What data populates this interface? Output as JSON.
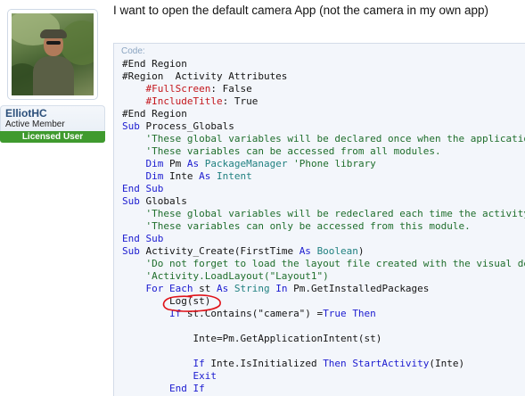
{
  "user": {
    "name": "ElliotHC",
    "title": "Active Member",
    "badge": "Licensed User"
  },
  "post": {
    "question": "I want to open the default camera App (not the camera in my own app)"
  },
  "code": {
    "label": "Code:",
    "lines": [
      [
        [
          "#End Region",
          "plain"
        ]
      ],
      [
        [
          "#Region  Activity Attributes",
          "plain"
        ]
      ],
      [
        [
          "    ",
          "plain"
        ],
        [
          "#FullScreen",
          "pragma"
        ],
        [
          ": ",
          "plain"
        ],
        [
          "False",
          "plain"
        ]
      ],
      [
        [
          "    ",
          "plain"
        ],
        [
          "#IncludeTitle",
          "pragma"
        ],
        [
          ": ",
          "plain"
        ],
        [
          "True",
          "plain"
        ]
      ],
      [
        [
          "#End Region",
          "plain"
        ]
      ],
      [
        [
          "Sub",
          "kw"
        ],
        [
          " Process_Globals",
          "plain"
        ]
      ],
      [
        [
          "    'These global variables will be declared once when the application",
          "comment"
        ]
      ],
      [
        [
          "    'These variables can be accessed from all modules.",
          "comment"
        ]
      ],
      [
        [
          "    ",
          "plain"
        ],
        [
          "Dim",
          "kw"
        ],
        [
          " Pm ",
          "plain"
        ],
        [
          "As",
          "kw"
        ],
        [
          " ",
          "plain"
        ],
        [
          "PackageManager",
          "type"
        ],
        [
          " ",
          "plain"
        ],
        [
          "'Phone library",
          "comment"
        ]
      ],
      [
        [
          "    ",
          "plain"
        ],
        [
          "Dim",
          "kw"
        ],
        [
          " Inte ",
          "plain"
        ],
        [
          "As",
          "kw"
        ],
        [
          " ",
          "plain"
        ],
        [
          "Intent",
          "type"
        ]
      ],
      [
        [
          "End Sub",
          "kw"
        ]
      ],
      [
        [
          "Sub",
          "kw"
        ],
        [
          " Globals",
          "plain"
        ]
      ],
      [
        [
          "    'These global variables will be redeclared each time the activity",
          "comment"
        ]
      ],
      [
        [
          "    'These variables can only be accessed from this module.",
          "comment"
        ]
      ],
      [
        [
          "End Sub",
          "kw"
        ]
      ],
      [
        [
          "Sub",
          "kw"
        ],
        [
          " Activity_Create(FirstTime ",
          "plain"
        ],
        [
          "As",
          "kw"
        ],
        [
          " ",
          "plain"
        ],
        [
          "Boolean",
          "type"
        ],
        [
          ")",
          "plain"
        ]
      ],
      [
        [
          "    'Do not forget to load the layout file created with the visual de",
          "comment"
        ]
      ],
      [
        [
          "    'Activity.LoadLayout(\"Layout1\")",
          "comment"
        ]
      ],
      [
        [
          "    ",
          "plain"
        ],
        [
          "For Each",
          "kw"
        ],
        [
          " st ",
          "plain"
        ],
        [
          "As",
          "kw"
        ],
        [
          " ",
          "plain"
        ],
        [
          "String",
          "type"
        ],
        [
          " ",
          "plain"
        ],
        [
          "In",
          "kw"
        ],
        [
          " Pm.GetInstalledPackages",
          "plain"
        ]
      ],
      [
        [
          "        Log(st)",
          "plain"
        ]
      ],
      [
        [
          "        ",
          "plain"
        ],
        [
          "If",
          "kw"
        ],
        [
          " st.Contains(\"camera\") =",
          "plain"
        ],
        [
          "True",
          "kw"
        ],
        [
          " ",
          "plain"
        ],
        [
          "Then",
          "kw"
        ]
      ],
      [
        [
          "",
          "plain"
        ]
      ],
      [
        [
          "            Inte=Pm.GetApplicationIntent(st)",
          "plain"
        ]
      ],
      [
        [
          "",
          "plain"
        ]
      ],
      [
        [
          "            ",
          "plain"
        ],
        [
          "If",
          "kw"
        ],
        [
          " Inte.IsInitialized ",
          "plain"
        ],
        [
          "Then",
          "kw"
        ],
        [
          " ",
          "plain"
        ],
        [
          "StartActivity",
          "func"
        ],
        [
          "(Inte)",
          "plain"
        ]
      ],
      [
        [
          "            ",
          "plain"
        ],
        [
          "Exit",
          "kw"
        ]
      ],
      [
        [
          "        ",
          "plain"
        ],
        [
          "End If",
          "kw"
        ]
      ]
    ]
  },
  "colors": {
    "keyword": "#1b1bd0",
    "type": "#208080",
    "comment": "#1f6e2c",
    "pragma": "#c4161c",
    "annotation_circle": "#e0141a",
    "badge_green": "#3f9a2e"
  },
  "icons": {
    "avatar": "user-photo",
    "annotation": "red-hand-drawn-circle"
  }
}
